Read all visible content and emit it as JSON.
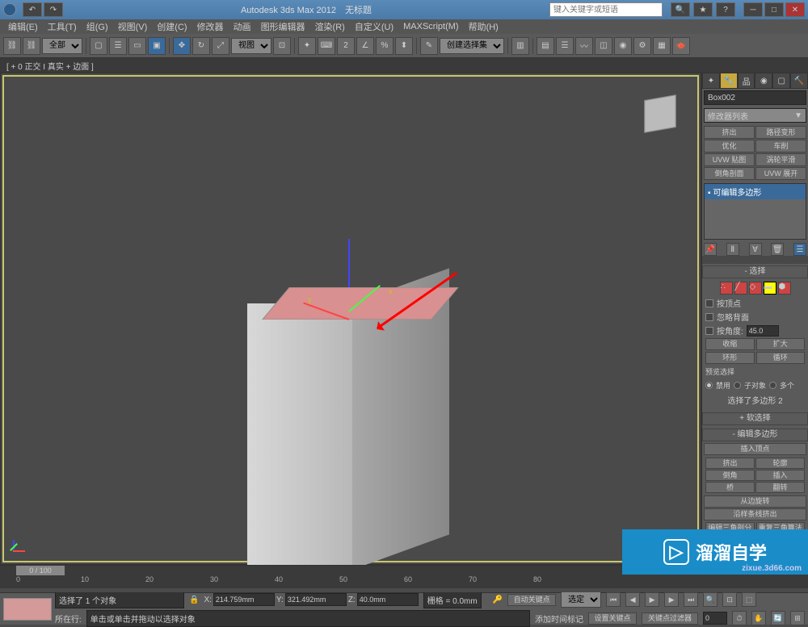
{
  "title": {
    "app": "Autodesk 3ds Max  2012",
    "doc": "无标题"
  },
  "search_placeholder": "键入关键字或短语",
  "menu": [
    "编辑(E)",
    "工具(T)",
    "组(G)",
    "视图(V)",
    "创建(C)",
    "修改器",
    "动画",
    "图形编辑器",
    "渲染(R)",
    "自定义(U)",
    "MAXScript(M)",
    "帮助(H)"
  ],
  "toolbar": {
    "scope": "全部",
    "view": "视图",
    "selset": "创建选择集"
  },
  "viewport_label": "[ + 0 正交 I 真实 + 边面 ]",
  "axis": {
    "x": "x",
    "y": "y",
    "z": ""
  },
  "panel": {
    "object_name": "Box002",
    "modifier_list": "修改器列表",
    "mod_buttons": [
      "挤出",
      "路径变形",
      "优化",
      "车削",
      "UVW 贴图",
      "涡轮平滑",
      "倒角剖面",
      "UVW 展开"
    ],
    "stack_item": "可编辑多边形",
    "rollouts": {
      "selection": "选择",
      "soft_sel": "软选择",
      "edit_poly": "编辑多边形"
    },
    "sel": {
      "by_vertex": "按顶点",
      "ignore_backface": "忽略背面",
      "by_angle": "按角度:",
      "angle_value": "45.0",
      "shrink": "收缩",
      "grow": "扩大",
      "ring": "环形",
      "loop": "循环",
      "preview_label": "预览选择",
      "preview_off": "禁用",
      "preview_sub": "子对象",
      "preview_multi": "多个",
      "status": "选择了多边形 2"
    },
    "edit": {
      "insert_vertex": "插入顶点",
      "extrude": "挤出",
      "outline": "轮廓",
      "bevel": "倒角",
      "inset": "插入",
      "bridge": "桥",
      "flip": "翻转",
      "hinge": "从边旋转",
      "extrude_spline": "沿样条线挤出",
      "edit_tri": "编辑三角剖分",
      "retri": "重复三角算法"
    }
  },
  "timeline": {
    "slider": "0 / 100",
    "ticks": [
      "0",
      "10",
      "20",
      "30",
      "40",
      "50",
      "60",
      "70",
      "80"
    ]
  },
  "status": {
    "selected": "选择了 1 个对象",
    "hint": "单击或单击并拖动以选择对象",
    "x": "214.759mm",
    "y": "321.492mm",
    "z": "40.0mm",
    "grid": "栅格 = 0.0mm",
    "auto_key": "自动关键点",
    "sel_lock": "选定对象",
    "set_key": "设置关键点",
    "key_filter": "关键点过滤器",
    "add_marker": "添加时间标记",
    "current_row": "所在行:"
  },
  "watermark": {
    "text": "溜溜自学",
    "url": "zixue.3d66.com"
  }
}
